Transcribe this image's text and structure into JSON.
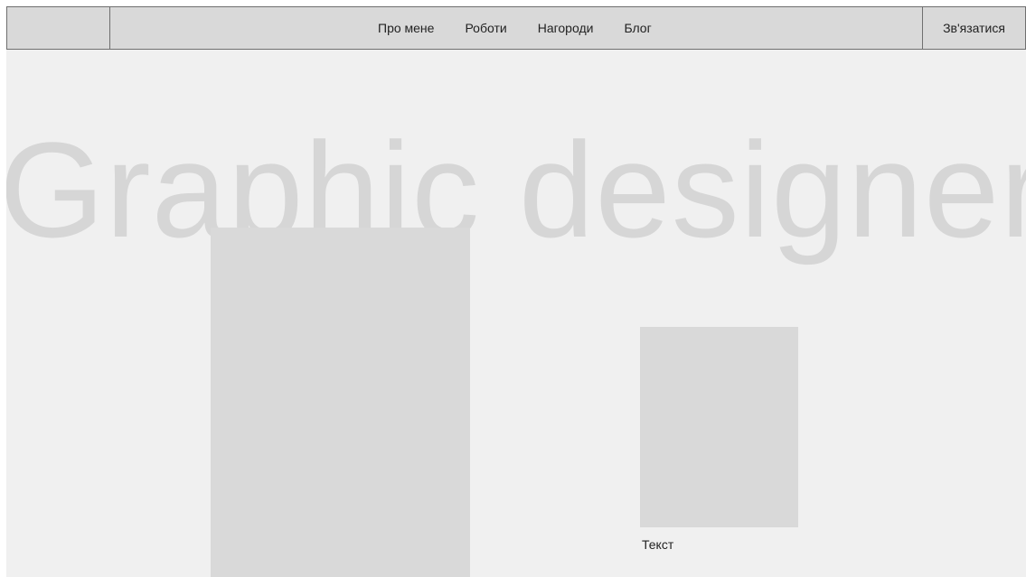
{
  "navbar": {
    "links": [
      "Про мене",
      "Роботи",
      "Нагороди",
      "Блог"
    ],
    "contact_label": "Зв'язатися"
  },
  "hero": {
    "title": "Graphic designer"
  },
  "gallery": {
    "caption": "Текст"
  },
  "colors": {
    "page_background": "#f0f0f0",
    "navbar_background": "#d9d9d9",
    "placeholder": "#d9d9d9",
    "hero_text": "#d6d6d6",
    "border": "#6f6f6f"
  }
}
